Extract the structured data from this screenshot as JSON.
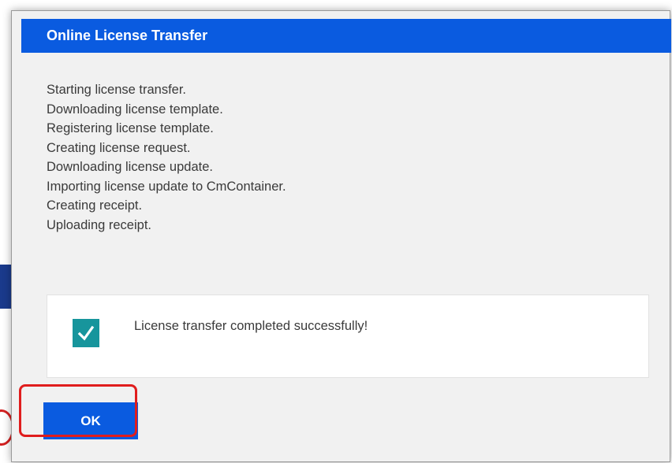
{
  "dialog": {
    "title": "Online License Transfer",
    "log_lines": [
      "Starting license transfer.",
      "Downloading license template.",
      "Registering license template.",
      "Creating license request.",
      "Downloading license update.",
      "Importing license update to CmContainer.",
      "Creating receipt.",
      "Uploading receipt."
    ],
    "result": {
      "message": "License transfer completed successfully!",
      "status_icon": "checkmark-icon"
    },
    "ok_label": "OK"
  },
  "colors": {
    "accent": "#0a5be0",
    "success": "#17959c",
    "annotation": "#e01d1d"
  }
}
